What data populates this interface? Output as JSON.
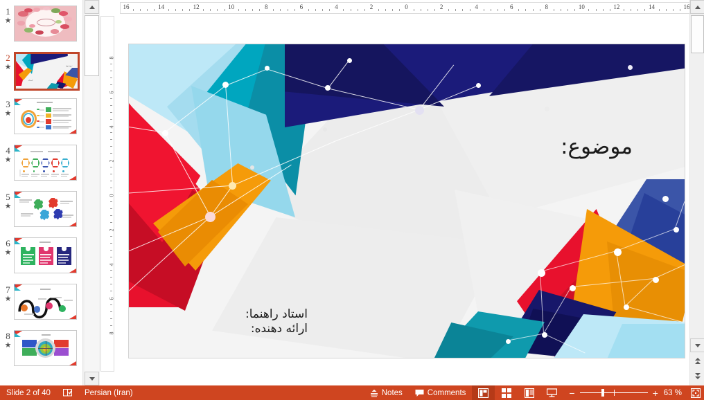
{
  "app": {
    "name": "PowerPoint Normal View"
  },
  "rulers": {
    "horizontal": {
      "labels": [
        16,
        14,
        12,
        10,
        8,
        6,
        4,
        2,
        0,
        2,
        4,
        6,
        8,
        10,
        12,
        14,
        16
      ],
      "unit": "cm"
    },
    "vertical": {
      "labels": [
        8,
        6,
        4,
        2,
        0,
        2,
        4,
        6,
        8
      ],
      "unit": "cm"
    }
  },
  "thumbnails": {
    "panel_label": "Slide Thumbnails",
    "selected_index": 2,
    "items": [
      {
        "number": "1",
        "star": "★",
        "kind": "floral-title",
        "selected": false
      },
      {
        "number": "2",
        "star": "★",
        "kind": "polygon-title",
        "selected": true
      },
      {
        "number": "3",
        "star": "★",
        "kind": "circle-chart",
        "selected": false
      },
      {
        "number": "4",
        "star": "★",
        "kind": "hexagon-row",
        "selected": false
      },
      {
        "number": "5",
        "star": "★",
        "kind": "gear-cluster",
        "selected": false
      },
      {
        "number": "6",
        "star": "★",
        "kind": "three-cards",
        "selected": false
      },
      {
        "number": "7",
        "star": "★",
        "kind": "wave-dots",
        "selected": false
      },
      {
        "number": "8",
        "star": "★",
        "kind": "target-blocks",
        "selected": false
      }
    ]
  },
  "slide": {
    "title": "موضوع:",
    "subtitle_line1": "استاد راهنما:",
    "subtitle_line2": "ارائه دهنده:",
    "palette": {
      "red": "#e8112d",
      "red_dark": "#c60d25",
      "orange": "#f59b09",
      "orange_dark": "#ec8a04",
      "navy": "#1b1b7a",
      "navy_dark": "#14145e",
      "blue": "#3b55a8",
      "teal": "#00a6bf",
      "teal_dark": "#0a8fa3",
      "skyblue": "#a8e2f5",
      "skyblue_light": "#c5ecf9",
      "background": "#f2f2f2"
    }
  },
  "status_bar": {
    "slide_counter": "Slide 2 of 40",
    "accessibility_icon": "accessibility-check-icon",
    "language": "Persian (Iran)",
    "notes_label": "Notes",
    "notes_icon": "notes-icon",
    "comments_label": "Comments",
    "comments_icon": "comment-icon",
    "views": [
      {
        "name": "normal-view",
        "icon": "normal-view-icon",
        "active": true
      },
      {
        "name": "slide-sorter-view",
        "icon": "slide-sorter-icon",
        "active": false
      },
      {
        "name": "reading-view",
        "icon": "reading-view-icon",
        "active": false
      },
      {
        "name": "slide-show-view",
        "icon": "slide-show-icon",
        "active": false
      }
    ],
    "zoom_out_label": "−",
    "zoom_in_label": "+",
    "zoom_percent": "63 %",
    "zoom_value": 63,
    "fit_label": "fit-to-window-icon",
    "accent_color": "#cf4520"
  },
  "scrollbars": {
    "thumbnail_panel": {
      "name": "thumbnail-scrollbar"
    },
    "canvas": {
      "name": "canvas-scrollbar"
    },
    "prev_slide": {
      "name": "previous-slide-button"
    },
    "next_slide": {
      "name": "next-slide-button"
    }
  }
}
